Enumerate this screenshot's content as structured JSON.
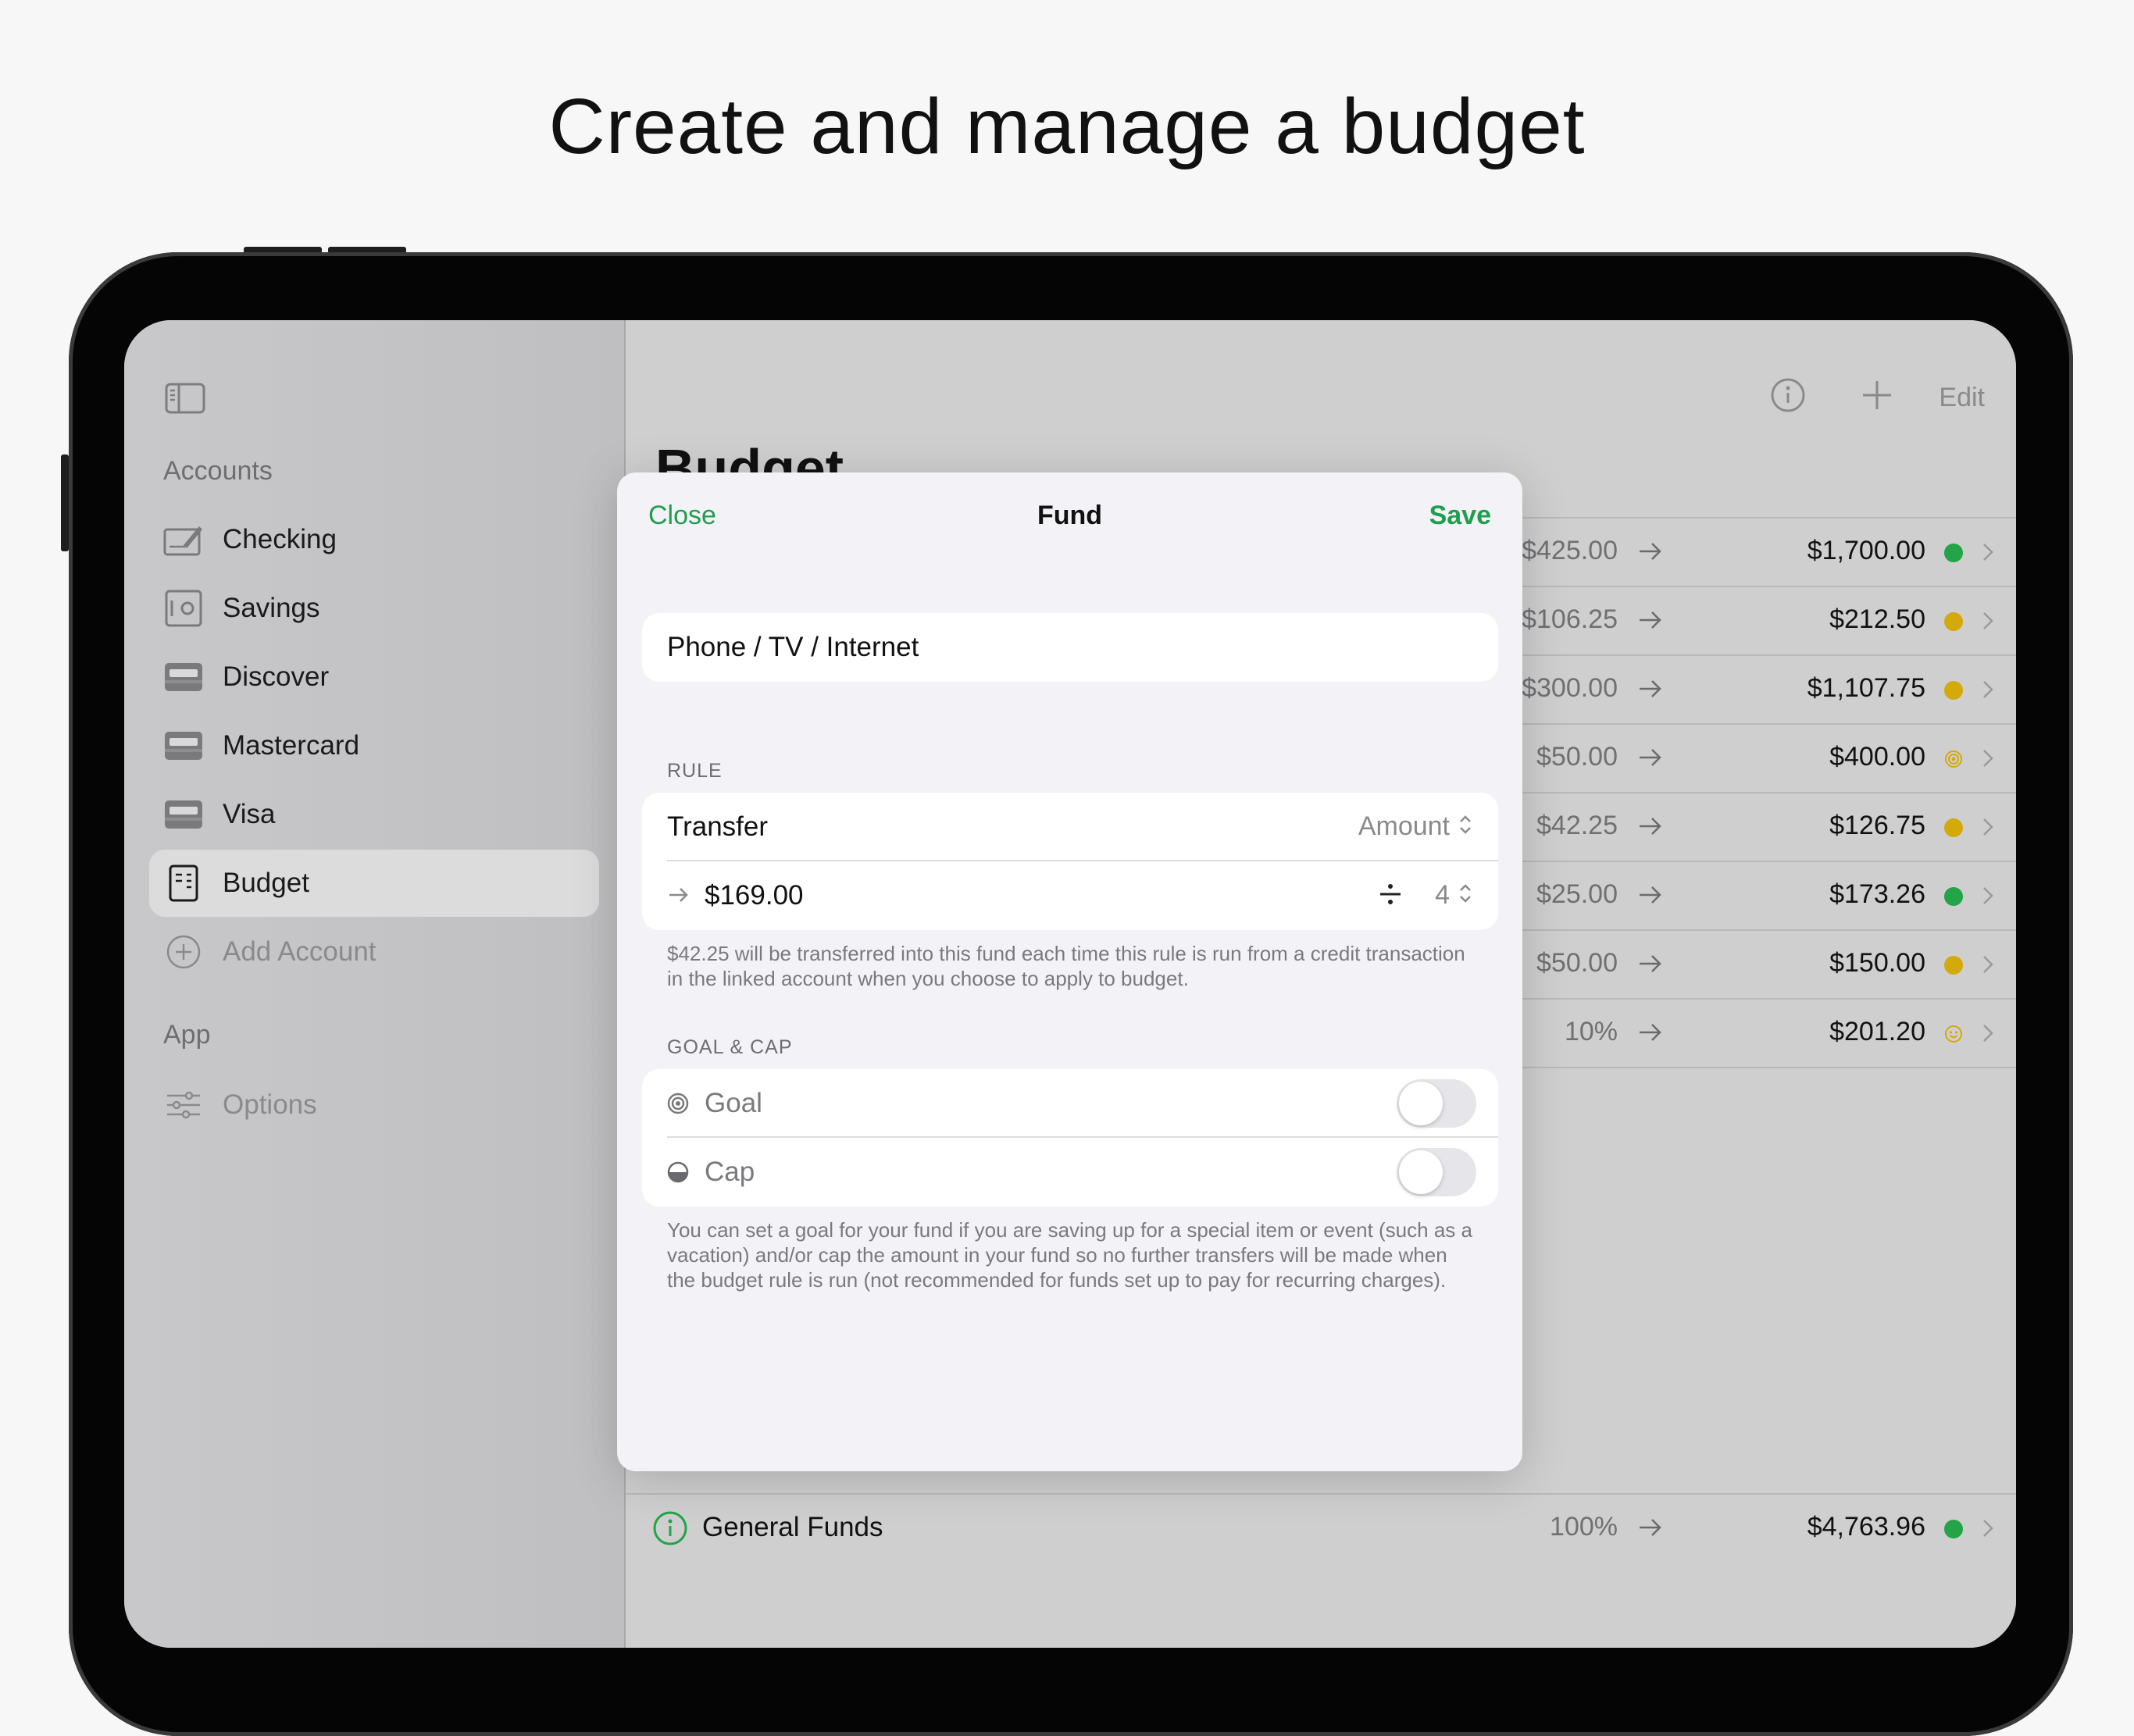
{
  "headline": "Create and manage a budget",
  "sidebar": {
    "accounts_heading": "Accounts",
    "items": [
      {
        "label": "Checking",
        "icon": "checkbook-icon"
      },
      {
        "label": "Savings",
        "icon": "safe-icon"
      },
      {
        "label": "Discover",
        "icon": "card-icon"
      },
      {
        "label": "Mastercard",
        "icon": "card-icon"
      },
      {
        "label": "Visa",
        "icon": "card-icon"
      },
      {
        "label": "Budget",
        "icon": "budget-icon",
        "selected": true
      }
    ],
    "add_account": "Add Account",
    "app_heading": "App",
    "options": "Options"
  },
  "toolbar": {
    "edit": "Edit"
  },
  "main": {
    "title": "Budget",
    "rows": [
      {
        "rule": "$425.00",
        "amount": "$1,700.00",
        "status": "green"
      },
      {
        "rule": "$106.25",
        "amount": "$212.50",
        "status": "yellow"
      },
      {
        "rule": "$300.00",
        "amount": "$1,107.75",
        "status": "yellow"
      },
      {
        "rule": "$50.00",
        "amount": "$400.00",
        "status": "goal"
      },
      {
        "rule": "$42.25",
        "amount": "$126.75",
        "status": "yellow"
      },
      {
        "rule": "$25.00",
        "amount": "$173.26",
        "status": "green"
      },
      {
        "rule": "$50.00",
        "amount": "$150.00",
        "status": "yellow"
      },
      {
        "rule": "10%",
        "amount": "$201.20",
        "status": "smile"
      }
    ],
    "general_funds": {
      "label": "General Funds",
      "rule": "100%",
      "amount": "$4,763.96",
      "status": "green"
    }
  },
  "colors": {
    "accent": "#1f9e4c",
    "green": "#22a447",
    "yellow": "#d4a90a"
  },
  "modal": {
    "close": "Close",
    "title": "Fund",
    "save": "Save",
    "fund_name": "Phone / TV / Internet",
    "rule_label": "RULE",
    "transfer_label": "Transfer",
    "transfer_type": "Amount",
    "transfer_amount": "$169.00",
    "divide_by": "4",
    "rule_footer": "$42.25 will be transferred into this fund each time this rule is run from a credit transaction in the linked account when you choose to apply to budget.",
    "goal_cap_label": "GOAL & CAP",
    "goal": "Goal",
    "goal_on": false,
    "cap": "Cap",
    "cap_on": false,
    "goal_footer": "You can set a goal for your fund if you are saving up for a special item or event (such as a vacation) and/or cap the amount in your fund so no further transfers will be made when the budget rule is run (not recommended for funds set up to pay for recurring charges)."
  }
}
